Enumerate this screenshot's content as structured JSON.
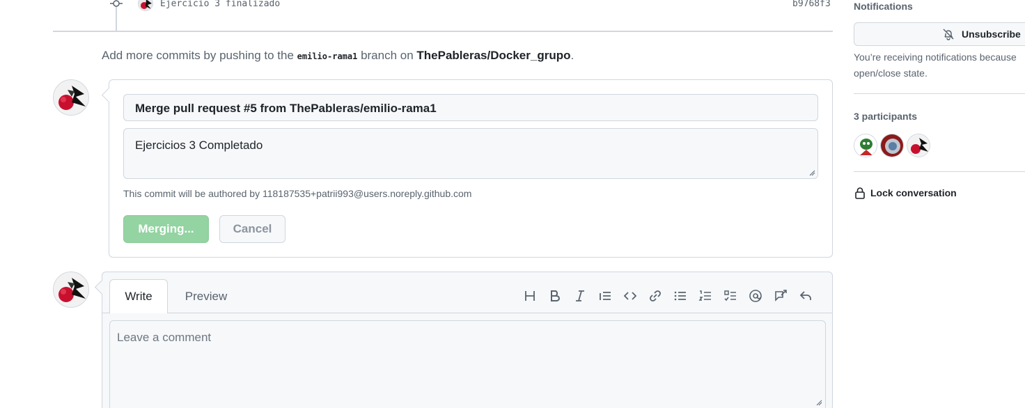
{
  "commit": {
    "message": "Ejercicio 3 finalizado",
    "sha": "b9768f3"
  },
  "push_hint": {
    "prefix": "Add more commits by pushing to the ",
    "branch": "emilio-rama1",
    "middle": " branch on ",
    "repo": "ThePableras/Docker_grupo",
    "suffix": "."
  },
  "merge": {
    "title_value": "Merge pull request #5 from ThePableras/emilio-rama1",
    "body_value": "Ejercicios 3 Completado",
    "author_note": "This commit will be authored by 118187535+patrii993@users.noreply.github.com",
    "merging_label": "Merging...",
    "cancel_label": "Cancel",
    "merging_color": "#94d3a2"
  },
  "comment": {
    "tabs": [
      "Write",
      "Preview"
    ],
    "placeholder": "Leave a comment",
    "toolbar_icons": [
      "heading-icon",
      "bold-icon",
      "italic-icon",
      "quote-icon",
      "code-icon",
      "link-icon",
      "unordered-list-icon",
      "ordered-list-icon",
      "task-list-icon",
      "mention-icon",
      "cross-reference-icon",
      "reply-icon"
    ]
  },
  "sidebar": {
    "notifications_heading": "Notifications",
    "unsubscribe_label": "Unsubscribe",
    "notif_line1": "You’re receiving notifications because",
    "notif_line2": "open/close state.",
    "participants_heading": "3 participants",
    "lock_label": "Lock conversation"
  }
}
